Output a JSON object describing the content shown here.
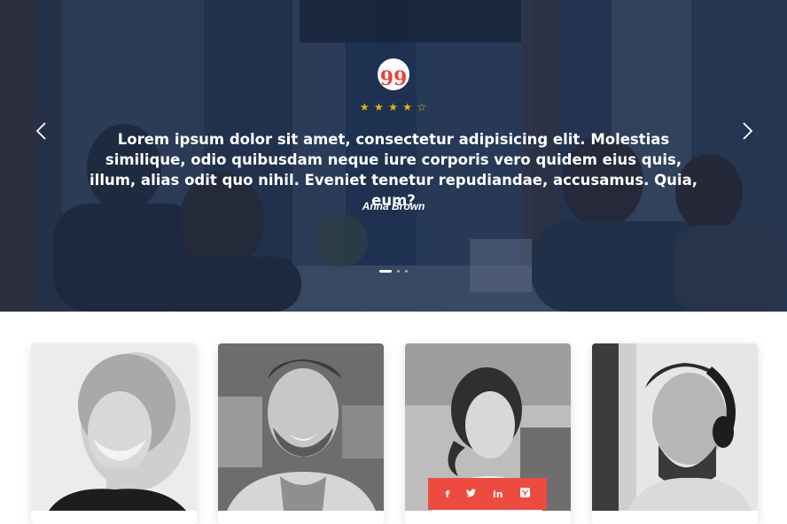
{
  "testimonial": {
    "quote_icon": "99",
    "stars": [
      "★",
      "★",
      "★",
      "★",
      "☆"
    ],
    "rating": 4,
    "text": "Lorem ipsum dolor sit amet, consectetur adipisicing elit. Molestias similique, odio quibusdam neque iure corporis vero quidem eius quis, illum, alias odit quo nihil. Eveniet tenetur repudiandae, accusamus. Quia, eum?",
    "author": "Anna Brown",
    "slide_count": 3,
    "active_slide": 1
  },
  "team": {
    "members": [
      {
        "photo": "woman-smiling-portrait"
      },
      {
        "photo": "man-smiling-portrait"
      },
      {
        "photo": "woman-laptop-portrait",
        "social": [
          "f",
          "twitter-icon",
          "in",
          "vimeo-icon"
        ]
      },
      {
        "photo": "man-headphones-portrait"
      }
    ],
    "social_labels": {
      "facebook": "f",
      "linkedin": "in"
    }
  },
  "colors": {
    "accent": "#ed4b3f",
    "star": "#f5b000",
    "hero_overlay": "#142648"
  }
}
